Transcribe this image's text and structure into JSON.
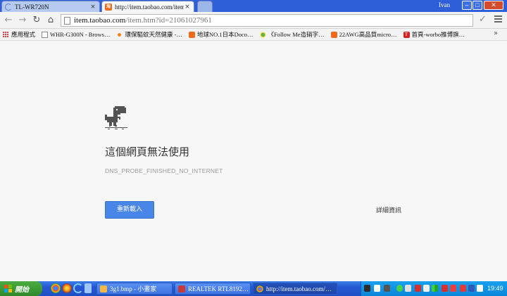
{
  "tabs": [
    {
      "title": "TL-WR720N",
      "close": "×"
    },
    {
      "title": "http://item.taobao.com/item.ht",
      "close": "×"
    }
  ],
  "window": {
    "user": "Ivan",
    "min": "–",
    "max": "□",
    "close": "✕"
  },
  "toolbar": {
    "back": "←",
    "forward": "→",
    "reload": "↻",
    "home": "⌂",
    "url_host": "item.taobao.com",
    "url_path": "/item.htm?id=21061027961",
    "star": "☆",
    "check": "✓"
  },
  "bookmarks": [
    {
      "label": "應用程式",
      "icon": "apps-icon"
    },
    {
      "label": "WHR-G300N - Brows…",
      "icon": "page-icon"
    },
    {
      "label": "環保驅蚊天然健康 -…",
      "icon": "sun-icon"
    },
    {
      "label": "地球NO.1日本Doco…",
      "icon": "taobao-icon"
    },
    {
      "label": "《Follow Me造硝字…",
      "icon": "pinwheel-icon"
    },
    {
      "label": "22AWG高品質micro…",
      "icon": "taobao-icon"
    },
    {
      "label": "首頁-worbo推博旗…",
      "icon": "t-icon"
    }
  ],
  "bookmarks_more": "»",
  "error": {
    "title": "這個網頁無法使用",
    "code": "DNS_PROBE_FINISHED_NO_INTERNET",
    "reload_label": "重新載入",
    "details_label": "詳細資訊"
  },
  "taskbar": {
    "start_label": "開始",
    "tasks": [
      {
        "label": "3g1.bmp - 小畫家"
      },
      {
        "label": "REALTEK RTL8192…"
      },
      {
        "label": "http://item.taobao.com/…"
      }
    ],
    "clock": "19:49"
  }
}
